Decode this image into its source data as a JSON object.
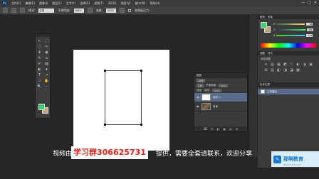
{
  "app": {
    "logo": "Ps"
  },
  "menubar": {
    "items": [
      "文件(F)",
      "编辑(E)",
      "图像(I)",
      "图层(L)",
      "文字(Y)",
      "选择(S)",
      "滤镜(T)",
      "3D(D)",
      "视图(V)",
      "窗口(W)",
      "帮助(H)"
    ],
    "window_controls": [
      "—",
      "□",
      "✕"
    ]
  },
  "optionsbar": {
    "mode_label": "模式:",
    "mode_value": "正常",
    "opacity_label": "不透明度:",
    "opacity_value": "100%",
    "flow_label": "流量:",
    "flow_value": "100%",
    "extra_label": "绘图板压力"
  },
  "toolbar": {
    "tools": [
      "↖",
      "⬚",
      "◌",
      "✂",
      "✜",
      "◉",
      "✎",
      "⌂",
      "✐",
      "▨",
      "◐",
      "✦",
      "T",
      "↗",
      "▭",
      "✋",
      "🔍",
      "⋯"
    ],
    "fg_color": "#3ad06b",
    "bg_color": "#c4a37a"
  },
  "layers_panel": {
    "tab": "图层",
    "kind_label": "ρ类型",
    "blend_mode": "正常",
    "opacity_label": "不透明度:",
    "opacity_value": "100%",
    "lock_label": "锁定:",
    "fill_label": "填充:",
    "fill_value": "100%",
    "layers": [
      {
        "name": "图层 1",
        "active": true
      },
      {
        "name": "背景",
        "active": false
      }
    ],
    "footer_icons": [
      "ↂ",
      "fx",
      "◐",
      "▣",
      "▤",
      "⊞"
    ]
  },
  "right_panel": {
    "color_tabs": [
      "颜色",
      "色板"
    ],
    "sliders": [
      {
        "label": "R",
        "value": "56",
        "color": "#ff4444"
      },
      {
        "label": "G",
        "value": "208",
        "color": "#3ad06b"
      },
      {
        "label": "B",
        "value": "107",
        "color": "#4477ff"
      }
    ],
    "adj_tabs": [
      "调整",
      "样式"
    ],
    "adj_subtitle": "添加调整",
    "adj_icons": [
      "☀",
      "▥",
      "▦",
      "◩",
      "▽",
      "◐",
      "◑",
      "▣",
      "⊞",
      "▤",
      "◧",
      "◨",
      "◪",
      "▩"
    ],
    "history_tabs": [
      "历史记录"
    ],
    "history_item": "工作路径"
  },
  "caption": {
    "prefix": "视频由",
    "qq_group": "学习群306625731",
    "suffix": "提供，需要全套请联系，欢迎分享"
  },
  "brand": {
    "logo_text": "那啊教育",
    "url": "www.lvoschool.com"
  }
}
